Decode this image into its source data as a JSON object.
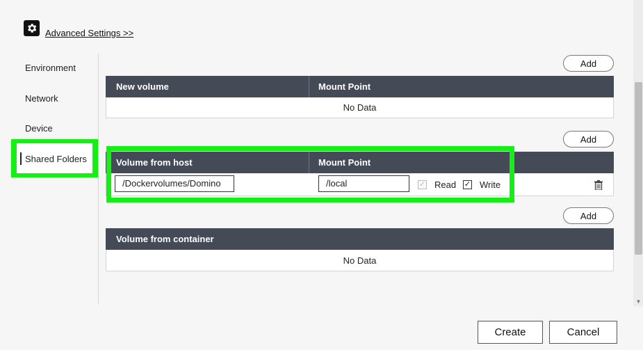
{
  "advanced": {
    "icon": "gear-icon",
    "link_label": "Advanced Settings >>"
  },
  "sidebar": {
    "items": [
      {
        "label": "Environment"
      },
      {
        "label": "Network"
      },
      {
        "label": "Device"
      },
      {
        "label": "Shared Folders",
        "selected": true
      }
    ]
  },
  "sections": {
    "new_volume": {
      "add_label": "Add",
      "headers": [
        "New volume",
        "Mount Point"
      ],
      "empty_text": "No Data"
    },
    "volume_from_host": {
      "add_label": "Add",
      "headers": [
        "Volume from host",
        "Mount Point"
      ],
      "rows": [
        {
          "host_path": "/Dockervolumes/Domino",
          "mount_point": "/local",
          "read_label": "Read",
          "read_checked": true,
          "read_disabled": true,
          "write_label": "Write",
          "write_checked": true,
          "delete_icon": "trash-icon"
        }
      ]
    },
    "volume_from_container": {
      "add_label": "Add",
      "headers": [
        "Volume from container"
      ],
      "empty_text": "No Data"
    }
  },
  "footer": {
    "create_label": "Create",
    "cancel_label": "Cancel"
  },
  "colors": {
    "highlight": "#14f014",
    "table_header": "#444b57"
  }
}
